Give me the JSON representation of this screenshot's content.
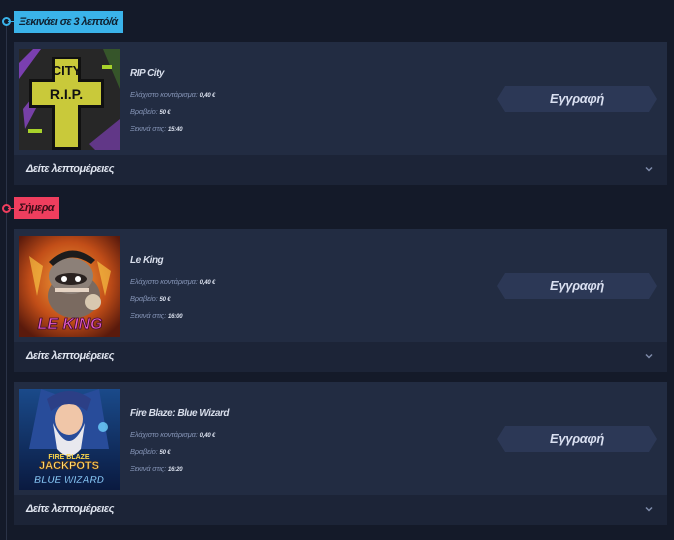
{
  "sections": [
    {
      "label": "Ξεκινάει σε 3 λεπτό/ά",
      "color": "#3ab3ea"
    },
    {
      "label": "Σήμερα",
      "color": "#ef3e5e"
    }
  ],
  "labels": {
    "min_bet": "Ελάχιστο κοντάρισμα:",
    "prize": "Βραβείο:",
    "starts": "Ξεκινά στις:",
    "register": "Εγγραφή",
    "details": "Δείτε λεπτομέρειες"
  },
  "cards": [
    {
      "title": "RIP City",
      "min_bet": "0,40 €",
      "prize": "50 €",
      "starts": "15:40",
      "thumb_icon": "rip-city-cross-icon",
      "thumb_text": [
        "R.I.P.",
        "CITY"
      ]
    },
    {
      "title": "Le King",
      "min_bet": "0,40 €",
      "prize": "50 €",
      "starts": "16:00",
      "thumb_icon": "le-king-raccoon-icon",
      "thumb_text": [
        "LE KING"
      ]
    },
    {
      "title": "Fire Blaze: Blue Wizard",
      "min_bet": "0,40 €",
      "prize": "50 €",
      "starts": "16:20",
      "thumb_icon": "blue-wizard-icon",
      "thumb_text": [
        "FIRE BLAZE",
        "JACKPOTS",
        "BLUE WIZARD"
      ]
    }
  ]
}
